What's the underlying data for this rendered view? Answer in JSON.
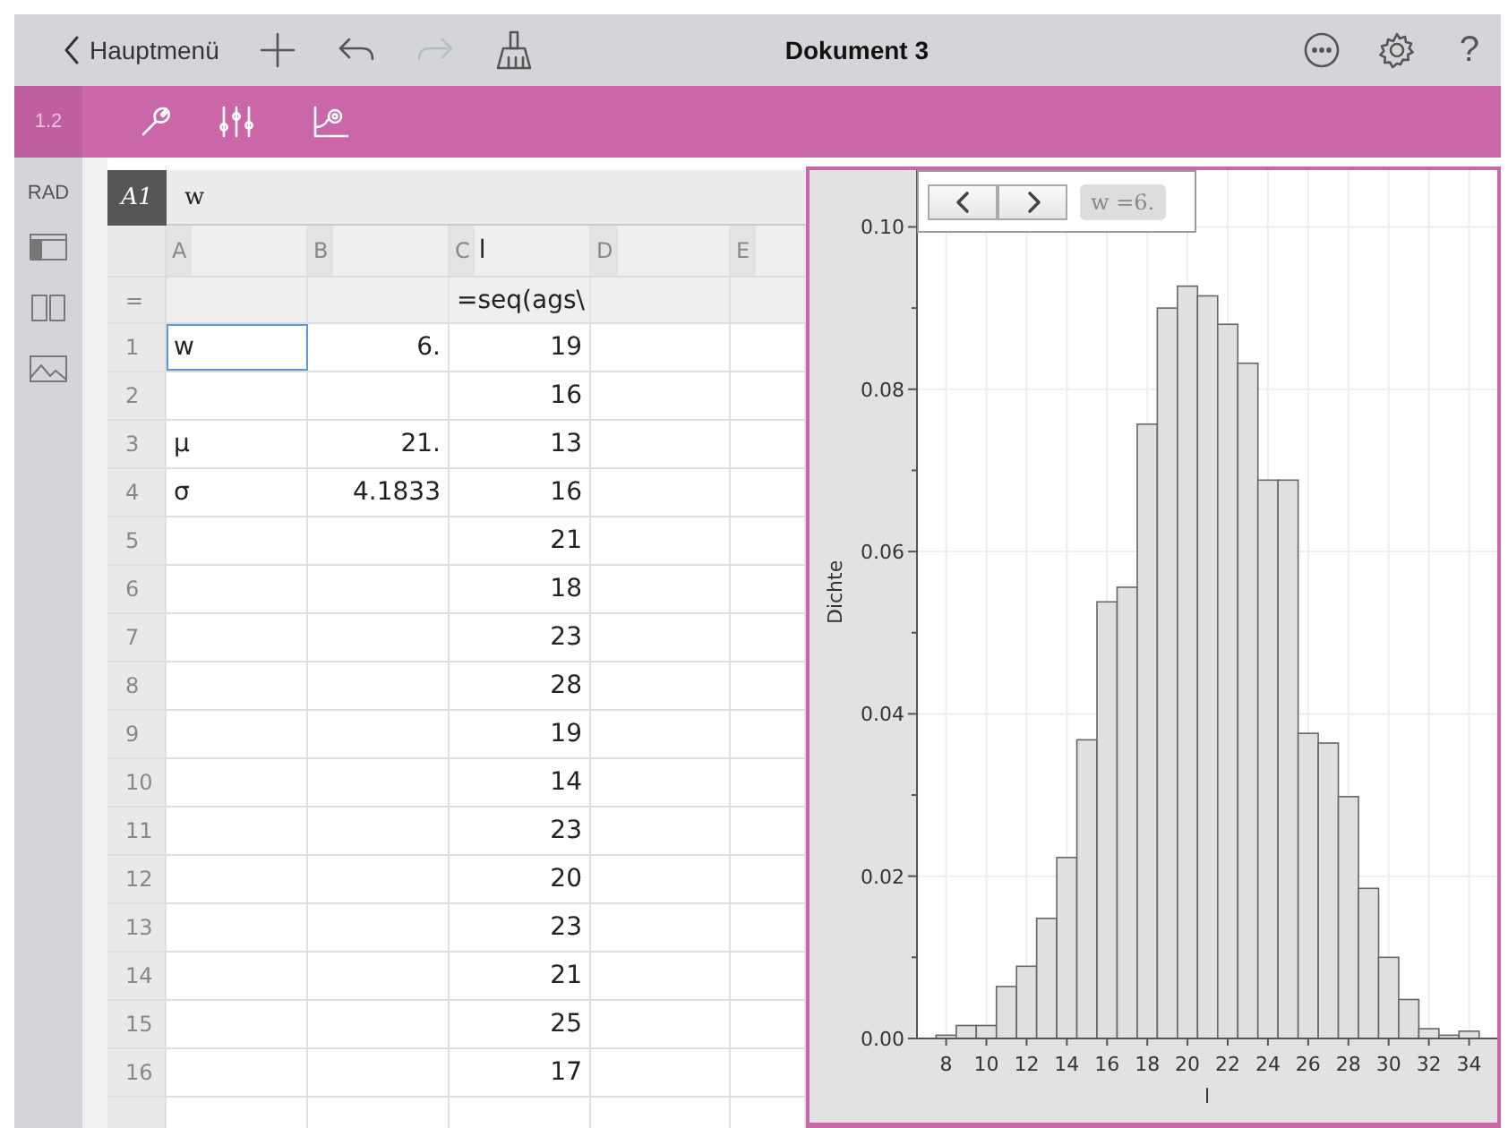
{
  "toolbar": {
    "back": "Hauptmenü",
    "title": "Dokument 3",
    "help": "?"
  },
  "page_bar": {
    "page": "1.2"
  },
  "sidebar": {
    "mode": "RAD"
  },
  "spreadsheet": {
    "cell_ref": "A1",
    "entry": "w",
    "columns": [
      {
        "letter": "A"
      },
      {
        "letter": "B"
      },
      {
        "letter": "C",
        "name": "l"
      },
      {
        "letter": "D"
      },
      {
        "letter": "E"
      }
    ],
    "formula_label": "=",
    "formula_c": "=seq(ags\\",
    "rows": [
      {
        "num": "1",
        "a": "w",
        "b": "6.",
        "c": "19",
        "selected": true
      },
      {
        "num": "2",
        "c": "16",
        "selected": false
      },
      {
        "num": "3",
        "a": "μ",
        "b": "21.",
        "c": "13",
        "selected": false
      },
      {
        "num": "4",
        "a": "σ",
        "b": "4.1833",
        "c": "16",
        "selected": false
      },
      {
        "num": "5",
        "c": "21",
        "selected": false
      },
      {
        "num": "6",
        "c": "18",
        "selected": false
      },
      {
        "num": "7",
        "c": "23",
        "selected": false
      },
      {
        "num": "8",
        "c": "28",
        "selected": false
      },
      {
        "num": "9",
        "c": "19",
        "selected": false
      },
      {
        "num": "10",
        "c": "14",
        "selected": false
      },
      {
        "num": "11",
        "c": "23",
        "selected": false
      },
      {
        "num": "12",
        "c": "20",
        "selected": false
      },
      {
        "num": "13",
        "c": "23",
        "selected": false
      },
      {
        "num": "14",
        "c": "21",
        "selected": false
      },
      {
        "num": "15",
        "c": "25",
        "selected": false
      },
      {
        "num": "16",
        "c": "17",
        "selected": false
      }
    ]
  },
  "graph": {
    "slider_value": "w =6.",
    "chart_data": {
      "type": "bar",
      "xlabel": "l",
      "ylabel": "Dichte",
      "x": [
        8,
        9,
        10,
        11,
        12,
        13,
        14,
        15,
        16,
        17,
        18,
        19,
        20,
        21,
        22,
        23,
        24,
        25,
        26,
        27,
        28,
        29,
        30,
        31,
        32,
        33,
        34
      ],
      "grid": true,
      "series": [
        {
          "color": "#e0e0e0",
          "values": [
            0.0004,
            0.0016,
            0.0016,
            0.0064,
            0.0089,
            0.0148,
            0.0223,
            0.0368,
            0.0538,
            0.0556,
            0.0757,
            0.09,
            0.0927,
            0.0915,
            0.088,
            0.0832,
            0.0688,
            0.0688,
            0.0376,
            0.0364,
            0.0298,
            0.0185,
            0.01,
            0.0048,
            0.0012,
            0.0004,
            0.0009
          ]
        }
      ],
      "xlim": [
        6.55,
        35.4
      ],
      "ylim": [
        0,
        0.107
      ],
      "xticks": [
        8,
        10,
        12,
        14,
        16,
        18,
        20,
        22,
        24,
        26,
        28,
        30,
        32,
        34
      ],
      "yticks": [
        {
          "value": 0,
          "label": "0.00"
        },
        {
          "value": 0.02,
          "label": "0.02"
        },
        {
          "value": 0.04,
          "label": "0.04"
        },
        {
          "value": 0.06,
          "label": "0.06"
        },
        {
          "value": 0.08,
          "label": "0.08"
        },
        {
          "value": 0.1,
          "label": "0.10"
        }
      ]
    }
  }
}
